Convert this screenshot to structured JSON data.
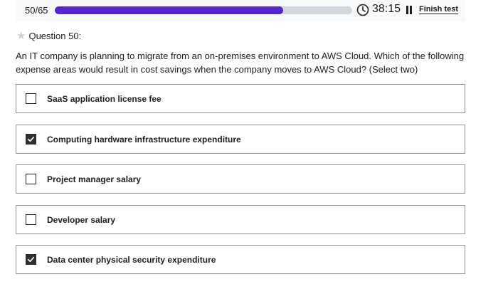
{
  "progress": {
    "count_label": "50/65",
    "fraction": 0.769,
    "fill_color": "#5624d0",
    "track_color": "#d1d7dc"
  },
  "timer": {
    "icon": "clock-icon",
    "value": "38:15"
  },
  "pause": {
    "icon": "pause-icon"
  },
  "finish_test_label": "Finish test",
  "question": {
    "star_icon": "star-icon",
    "header": "Question 50:",
    "text": "An IT company is planning to migrate from an on-premises environment to AWS Cloud. Which of the following expense areas would result in cost savings when the company moves to AWS Cloud? (Select two)"
  },
  "options": [
    {
      "label": "SaaS application license fee",
      "checked": false
    },
    {
      "label": "Computing hardware infrastructure expenditure",
      "checked": true
    },
    {
      "label": "Project manager salary",
      "checked": false
    },
    {
      "label": "Developer salary",
      "checked": false
    },
    {
      "label": "Data center physical security expenditure",
      "checked": true
    }
  ]
}
